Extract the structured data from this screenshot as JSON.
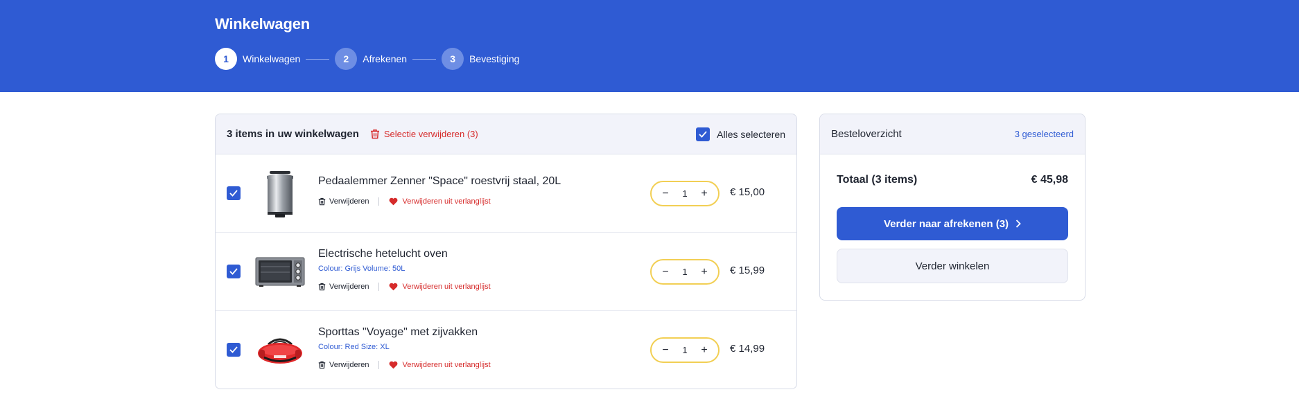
{
  "header": {
    "title": "Winkelwagen",
    "steps": [
      {
        "number": "1",
        "label": "Winkelwagen",
        "state": "active"
      },
      {
        "number": "2",
        "label": "Afrekenen",
        "state": "inactive"
      },
      {
        "number": "3",
        "label": "Bevestiging",
        "state": "inactive"
      }
    ]
  },
  "cart": {
    "count_label": "3 items in uw winkelwagen",
    "remove_selection_label": "Selectie verwijderen (3)",
    "select_all_label": "Alles selecteren",
    "select_all_checked": true,
    "items": [
      {
        "name": "Pedaalemmer Zenner \"Space\" roestvrij staal, 20L",
        "variant": "",
        "image_icon": "trash-bin-product-image",
        "remove_label": "Verwijderen",
        "wishlist_label": "Verwijderen uit verlanglijst",
        "quantity": "1",
        "price": "€ 15,00",
        "checked": true
      },
      {
        "name": "Electrische hetelucht oven",
        "variant": "Colour: Grijs Volume: 50L",
        "image_icon": "oven-product-image",
        "remove_label": "Verwijderen",
        "wishlist_label": "Verwijderen uit verlanglijst",
        "quantity": "1",
        "price": "€ 15,99",
        "checked": true
      },
      {
        "name": "Sporttas \"Voyage\" met zijvakken",
        "variant": "Colour: Red Size: XL",
        "image_icon": "sports-bag-product-image",
        "remove_label": "Verwijderen",
        "wishlist_label": "Verwijderen uit verlanglijst",
        "quantity": "1",
        "price": "€ 14,99",
        "checked": true
      }
    ]
  },
  "summary": {
    "title": "Besteloverzicht",
    "selected_label": "3 geselecteerd",
    "total_label": "Totaal (3 items)",
    "total_value": "€ 45,98",
    "checkout_button": "Verder naar afrekenen (3)",
    "continue_button": "Verder winkelen"
  },
  "colors": {
    "brand": "#2f5bd3",
    "danger": "#d62b2b",
    "quantity_border": "#f2cf54",
    "panel_header": "#f2f3fa"
  }
}
